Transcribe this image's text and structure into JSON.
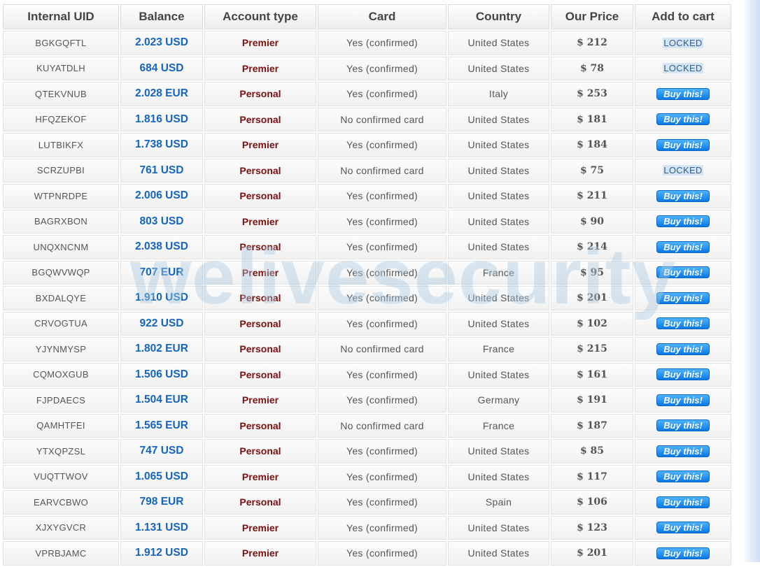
{
  "headers": [
    "Internal UID",
    "Balance",
    "Account type",
    "Card",
    "Country",
    "Our Price",
    "Add to cart"
  ],
  "watermark": "welivesecurity",
  "rows": [
    {
      "uid": "BGKGQFTL",
      "balance": "2.023 USD",
      "type": "Premier",
      "card": "Yes (confirmed)",
      "country": "United States",
      "price": "$ 212",
      "action": "LOCKED"
    },
    {
      "uid": "KUYATDLH",
      "balance": "684 USD",
      "type": "Premier",
      "card": "Yes (confirmed)",
      "country": "United States",
      "price": "$ 78",
      "action": "LOCKED"
    },
    {
      "uid": "QTEKVNUB",
      "balance": "2.028 EUR",
      "type": "Personal",
      "card": "Yes (confirmed)",
      "country": "Italy",
      "price": "$ 253",
      "action": "Buy this!"
    },
    {
      "uid": "HFQZEKOF",
      "balance": "1.816 USD",
      "type": "Personal",
      "card": "No confirmed card",
      "country": "United States",
      "price": "$ 181",
      "action": "Buy this!"
    },
    {
      "uid": "LUTBIKFX",
      "balance": "1.738 USD",
      "type": "Premier",
      "card": "Yes (confirmed)",
      "country": "United States",
      "price": "$ 184",
      "action": "Buy this!"
    },
    {
      "uid": "SCRZUPBI",
      "balance": "761 USD",
      "type": "Personal",
      "card": "No confirmed card",
      "country": "United States",
      "price": "$ 75",
      "action": "LOCKED"
    },
    {
      "uid": "WTPNRDPE",
      "balance": "2.006 USD",
      "type": "Personal",
      "card": "Yes (confirmed)",
      "country": "United States",
      "price": "$ 211",
      "action": "Buy this!"
    },
    {
      "uid": "BAGRXBON",
      "balance": "803 USD",
      "type": "Premier",
      "card": "Yes (confirmed)",
      "country": "United States",
      "price": "$ 90",
      "action": "Buy this!"
    },
    {
      "uid": "UNQXNCNM",
      "balance": "2.038 USD",
      "type": "Personal",
      "card": "Yes (confirmed)",
      "country": "United States",
      "price": "$ 214",
      "action": "Buy this!"
    },
    {
      "uid": "BGQWVWQP",
      "balance": "707 EUR",
      "type": "Premier",
      "card": "Yes (confirmed)",
      "country": "France",
      "price": "$ 95",
      "action": "Buy this!"
    },
    {
      "uid": "BXDALQYE",
      "balance": "1.910 USD",
      "type": "Personal",
      "card": "Yes (confirmed)",
      "country": "United States",
      "price": "$ 201",
      "action": "Buy this!"
    },
    {
      "uid": "CRVOGTUA",
      "balance": "922 USD",
      "type": "Personal",
      "card": "Yes (confirmed)",
      "country": "United States",
      "price": "$ 102",
      "action": "Buy this!"
    },
    {
      "uid": "YJYNMYSP",
      "balance": "1.802 EUR",
      "type": "Personal",
      "card": "No confirmed card",
      "country": "France",
      "price": "$ 215",
      "action": "Buy this!"
    },
    {
      "uid": "CQMOXGUB",
      "balance": "1.506 USD",
      "type": "Personal",
      "card": "Yes (confirmed)",
      "country": "United States",
      "price": "$ 161",
      "action": "Buy this!"
    },
    {
      "uid": "FJPDAECS",
      "balance": "1.504 EUR",
      "type": "Premier",
      "card": "Yes (confirmed)",
      "country": "Germany",
      "price": "$ 191",
      "action": "Buy this!"
    },
    {
      "uid": "QAMHTFEI",
      "balance": "1.565 EUR",
      "type": "Personal",
      "card": "No confirmed card",
      "country": "France",
      "price": "$ 187",
      "action": "Buy this!"
    },
    {
      "uid": "YTXQPZSL",
      "balance": "747 USD",
      "type": "Personal",
      "card": "Yes (confirmed)",
      "country": "United States",
      "price": "$ 85",
      "action": "Buy this!"
    },
    {
      "uid": "VUQTTWOV",
      "balance": "1.065 USD",
      "type": "Premier",
      "card": "Yes (confirmed)",
      "country": "United States",
      "price": "$ 117",
      "action": "Buy this!"
    },
    {
      "uid": "EARVCBWO",
      "balance": "798 EUR",
      "type": "Personal",
      "card": "Yes (confirmed)",
      "country": "Spain",
      "price": "$ 106",
      "action": "Buy this!"
    },
    {
      "uid": "XJXYGVCR",
      "balance": "1.131 USD",
      "type": "Premier",
      "card": "Yes (confirmed)",
      "country": "United States",
      "price": "$ 123",
      "action": "Buy this!"
    },
    {
      "uid": "VPRBJAMC",
      "balance": "1.912 USD",
      "type": "Premier",
      "card": "Yes (confirmed)",
      "country": "United States",
      "price": "$ 201",
      "action": "Buy this!"
    }
  ]
}
